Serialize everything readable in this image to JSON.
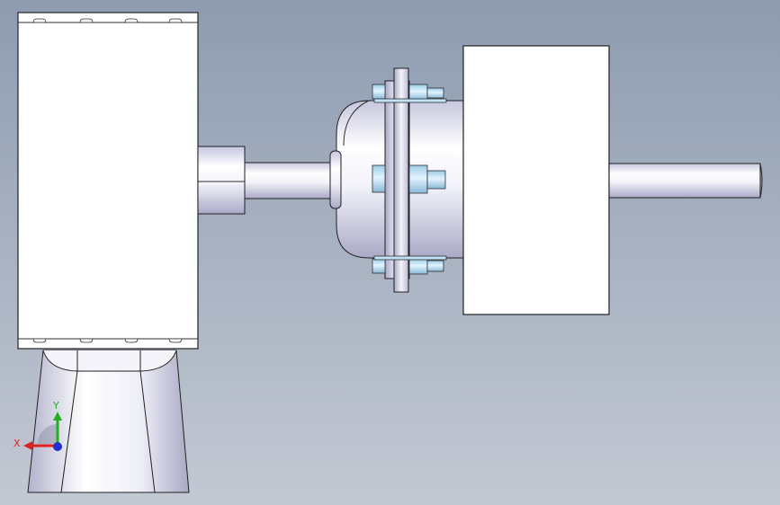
{
  "viewport": {
    "background_top": "#8e9bb0",
    "background_bottom": "#c3c9d3"
  },
  "model": {
    "parts": [
      "motor-housing",
      "motor-pedestal",
      "shaft-collar",
      "input-shaft",
      "coupling-hub",
      "coupling-flange",
      "hex-bolts",
      "bearing-block",
      "output-shaft"
    ]
  },
  "triad": {
    "x_label": "X",
    "y_label": "Y",
    "x_color": "#e02020",
    "y_color": "#20b020",
    "z_color": "#2030d0"
  }
}
